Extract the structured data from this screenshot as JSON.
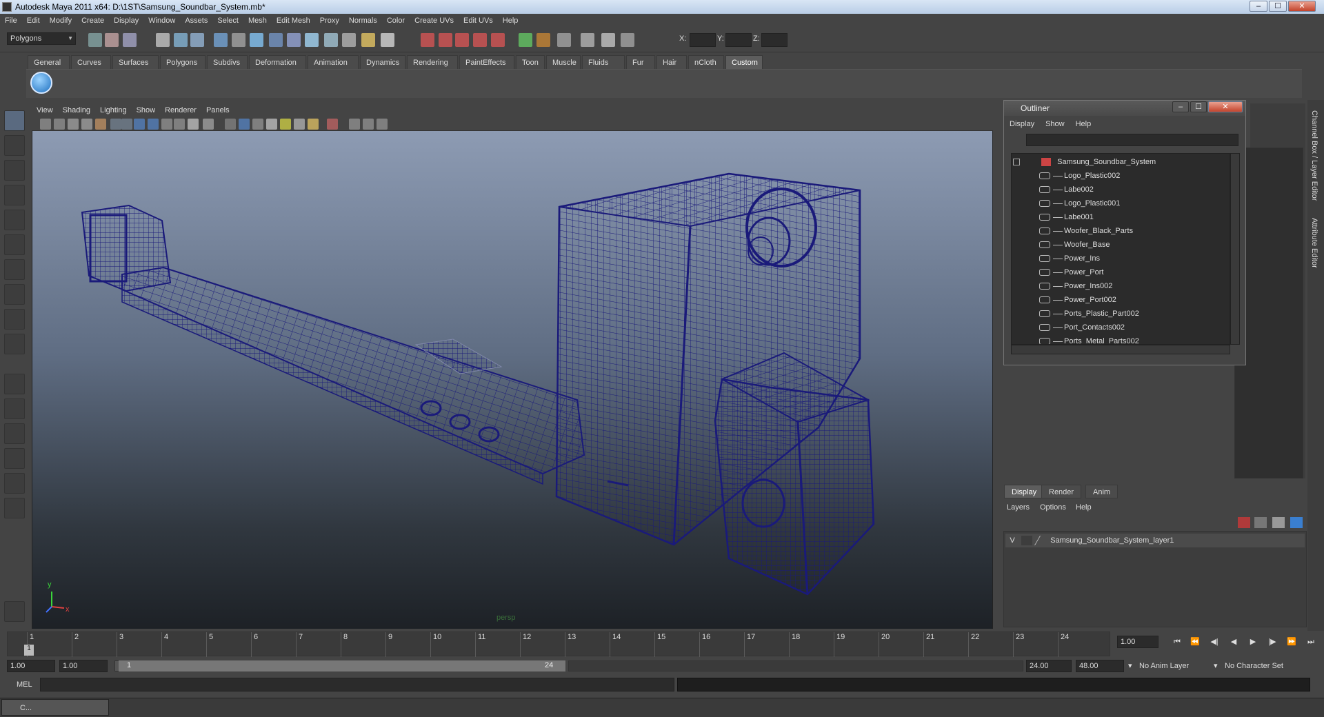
{
  "window": {
    "title": "Autodesk Maya 2011 x64: D:\\1ST\\Samsung_Soundbar_System.mb*",
    "min": "‒",
    "max": "☐",
    "close": "✕"
  },
  "menubar": [
    "File",
    "Edit",
    "Modify",
    "Create",
    "Display",
    "Window",
    "Assets",
    "Select",
    "Mesh",
    "Edit Mesh",
    "Proxy",
    "Normals",
    "Color",
    "Create UVs",
    "Edit UVs",
    "Help"
  ],
  "toolbar": {
    "mode": "Polygons",
    "x_label": "X:",
    "y_label": "Y:",
    "z_label": "Z:"
  },
  "shelf_tabs": [
    "General",
    "Curves",
    "Surfaces",
    "Polygons",
    "Subdivs",
    "Deformation",
    "Animation",
    "Dynamics",
    "Rendering",
    "PaintEffects",
    "Toon",
    "Muscle",
    "Fluids",
    "Fur",
    "Hair",
    "nCloth",
    "Custom"
  ],
  "shelf_active": "Custom",
  "viewport": {
    "menu": [
      "View",
      "Shading",
      "Lighting",
      "Show",
      "Renderer",
      "Panels"
    ],
    "camera_label": "persp",
    "axis_y": "y",
    "axis_x": "x"
  },
  "outliner": {
    "title": "Outliner",
    "menu": [
      "Display",
      "Show",
      "Help"
    ],
    "root": "Samsung_Soundbar_System",
    "items": [
      "Logo_Plastic002",
      "Labe002",
      "Logo_Plastic001",
      "Labe001",
      "Woofer_Black_Parts",
      "Woofer_Base",
      "Power_Ins",
      "Power_Port",
      "Power_Ins002",
      "Power_Port002",
      "Ports_Plastic_Part002",
      "Port_Contacts002",
      "Ports_Metal_Parts002"
    ]
  },
  "layers": {
    "tabs": [
      "Display",
      "Render",
      "Anim"
    ],
    "menu": [
      "Layers",
      "Options",
      "Help"
    ],
    "row_visibility": "V",
    "row_name": "Samsung_Soundbar_System_layer1"
  },
  "side_tabs": [
    "Channel Box / Layer Editor",
    "Attribute Editor"
  ],
  "timeline": {
    "ticks": [
      "1",
      "2",
      "3",
      "4",
      "5",
      "6",
      "7",
      "8",
      "9",
      "10",
      "11",
      "12",
      "13",
      "14",
      "15",
      "16",
      "17",
      "18",
      "19",
      "20",
      "21",
      "22",
      "23",
      "24"
    ],
    "current_frame": "1.00",
    "playhead": "1"
  },
  "range": {
    "start": "1.00",
    "start2": "1.00",
    "slider_start": "1",
    "slider_end": "24",
    "end": "24.00",
    "end2": "48.00",
    "anim_layer": "No Anim Layer",
    "char_set": "No Character Set"
  },
  "mel": {
    "label": "MEL"
  },
  "taskbar": {
    "item": "C..."
  },
  "colors": {
    "wire": "#1a1a7a",
    "bg_top": "#8d9bb3",
    "bg_bottom": "#1d2126",
    "accent": "#3c7fd0"
  }
}
